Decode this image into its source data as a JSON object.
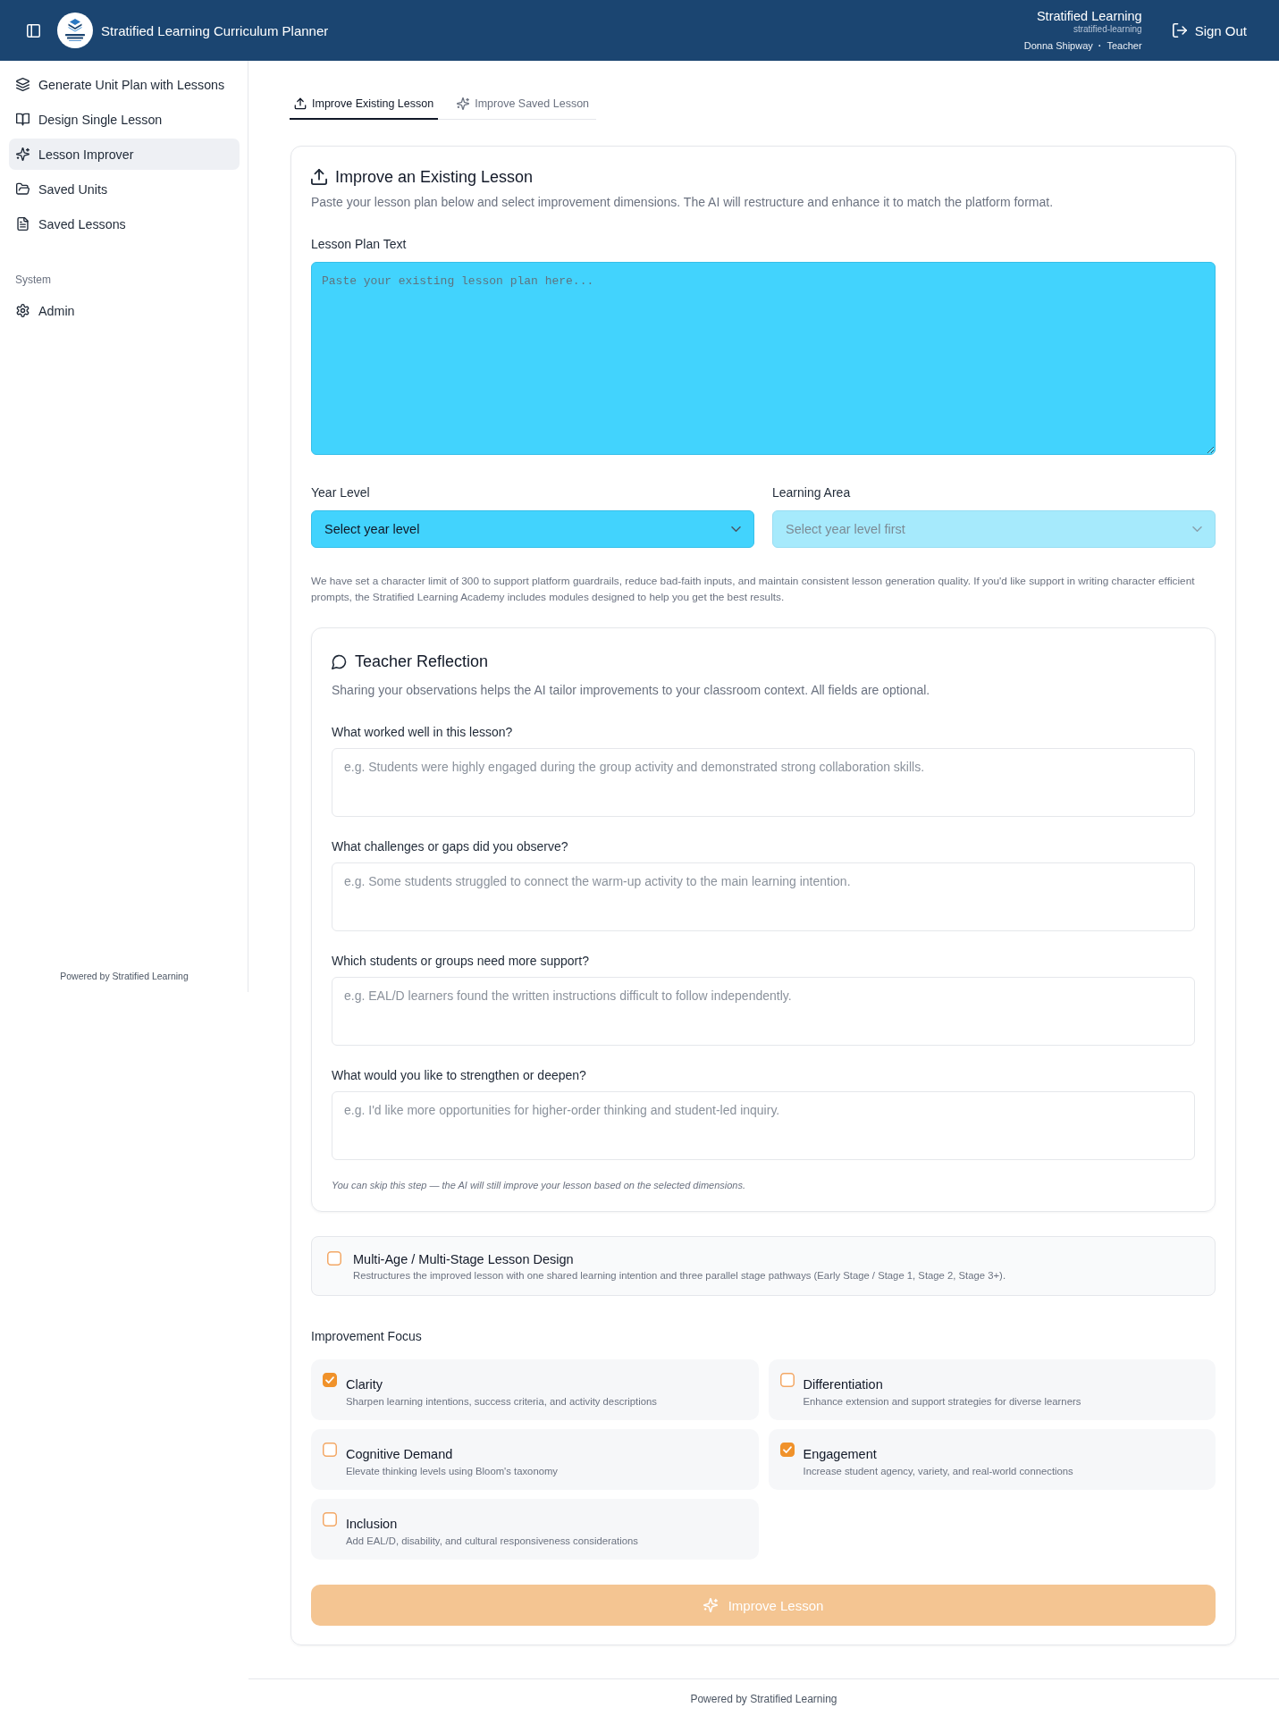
{
  "header": {
    "title": "Stratified Learning Curriculum Planner",
    "org_name": "Stratified Learning",
    "org_handle": "stratified-learning",
    "user_name": "Donna Shipway",
    "separator": "·",
    "role": "Teacher",
    "sign_out": "Sign Out"
  },
  "sidebar": {
    "items": [
      {
        "label": "Generate Unit Plan with Lessons",
        "selected": false
      },
      {
        "label": "Design Single Lesson",
        "selected": false
      },
      {
        "label": "Lesson Improver",
        "selected": true
      },
      {
        "label": "Saved Units",
        "selected": false
      },
      {
        "label": "Saved Lessons",
        "selected": false
      }
    ],
    "system_heading": "System",
    "system_items": [
      {
        "label": "Admin",
        "selected": false
      }
    ],
    "footer": "Powered by Stratified Learning"
  },
  "tabs": [
    {
      "label": "Improve Existing Lesson",
      "selected": true
    },
    {
      "label": "Improve Saved Lesson",
      "selected": false
    }
  ],
  "lesson_card": {
    "title": "Improve an Existing Lesson",
    "description": "Paste your lesson plan below and select improvement dimensions. The AI will restructure and enhance it to match the platform format.",
    "lesson_text": {
      "label": "Lesson Plan Text",
      "placeholder": "Paste your existing lesson plan here..."
    },
    "year_level": {
      "label": "Year Level",
      "value": "Select year level",
      "disabled": false
    },
    "learning_area": {
      "label": "Learning Area",
      "value": "Select year level first",
      "disabled": true
    },
    "note": "We have set a character limit of 300 to support platform guardrails, reduce bad-faith inputs, and maintain consistent lesson generation quality. If you'd like support in writing character efficient prompts, the Stratified Learning Academy includes modules designed to help you get the best results.",
    "reflection": {
      "title": "Teacher Reflection",
      "description": "Sharing your observations helps the AI tailor improvements to your classroom context. All fields are optional.",
      "questions": [
        {
          "label": "What worked well in this lesson?",
          "placeholder": "e.g. Students were highly engaged during the group activity and demonstrated strong collaboration skills."
        },
        {
          "label": "What challenges or gaps did you observe?",
          "placeholder": "e.g. Some students struggled to connect the warm-up activity to the main learning intention."
        },
        {
          "label": "Which students or groups need more support?",
          "placeholder": "e.g. EAL/D learners found the written instructions difficult to follow independently."
        },
        {
          "label": "What would you like to strengthen or deepen?",
          "placeholder": "e.g. I'd like more opportunities for higher-order thinking and student-led inquiry."
        }
      ],
      "footnote": "You can skip this step — the AI will still improve your lesson based on the selected dimensions."
    },
    "multi_stage": {
      "title": "Multi-Age / Multi-Stage Lesson Design",
      "description": "Restructures the improved lesson with one shared learning intention and three parallel stage pathways (Early Stage / Stage 1, Stage 2, Stage 3+).",
      "checked": false
    },
    "focus": {
      "heading": "Improvement Focus",
      "options": [
        {
          "title": "Clarity",
          "description": "Sharpen learning intentions, success criteria, and activity descriptions",
          "checked": true
        },
        {
          "title": "Differentiation",
          "description": "Enhance extension and support strategies for diverse learners",
          "checked": false
        },
        {
          "title": "Cognitive Demand",
          "description": "Elevate thinking levels using Bloom's taxonomy",
          "checked": false
        },
        {
          "title": "Engagement",
          "description": "Increase student agency, variety, and real-world connections",
          "checked": true
        },
        {
          "title": "Inclusion",
          "description": "Add EAL/D, disability, and cultural responsiveness considerations",
          "checked": false
        }
      ]
    },
    "submit": {
      "label": "Improve Lesson",
      "disabled": true
    }
  },
  "footer": "Powered by Stratified Learning"
}
